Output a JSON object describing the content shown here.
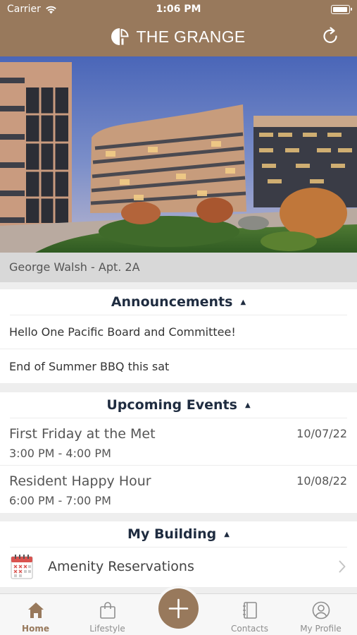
{
  "status_bar": {
    "carrier": "Carrier",
    "time": "1:06 PM"
  },
  "header": {
    "title": "THE GRANGE",
    "logo_icon": "grange-logo-icon",
    "refresh_icon": "refresh-icon"
  },
  "hero": {
    "image": "apartment-buildings-photo"
  },
  "resident": {
    "label": "George Walsh - Apt.  2A"
  },
  "announcements": {
    "title": "Announcements",
    "items": [
      "Hello One Pacific Board and Committee!",
      "End of Summer BBQ this sat"
    ]
  },
  "events": {
    "title": "Upcoming Events",
    "items": [
      {
        "name": "First Friday at the Met",
        "time": "3:00 PM - 4:00 PM",
        "date": "10/07/22"
      },
      {
        "name": "Resident Happy Hour",
        "time": "6:00 PM - 7:00 PM",
        "date": "10/08/22"
      }
    ]
  },
  "building": {
    "title": "My Building",
    "items": [
      {
        "label": "Amenity Reservations",
        "icon": "calendar-icon"
      }
    ]
  },
  "tabbar": {
    "items": [
      {
        "label": "Home",
        "icon": "home-icon",
        "active": true
      },
      {
        "label": "Lifestyle",
        "icon": "shopping-bag-icon",
        "active": false
      },
      {
        "label": "Contacts",
        "icon": "contacts-book-icon",
        "active": false
      },
      {
        "label": "My Profile",
        "icon": "profile-icon",
        "active": false
      }
    ],
    "add_icon": "plus-icon"
  },
  "colors": {
    "brand": "#98795c",
    "heading": "#1f2c40",
    "background": "#eeeeee"
  }
}
